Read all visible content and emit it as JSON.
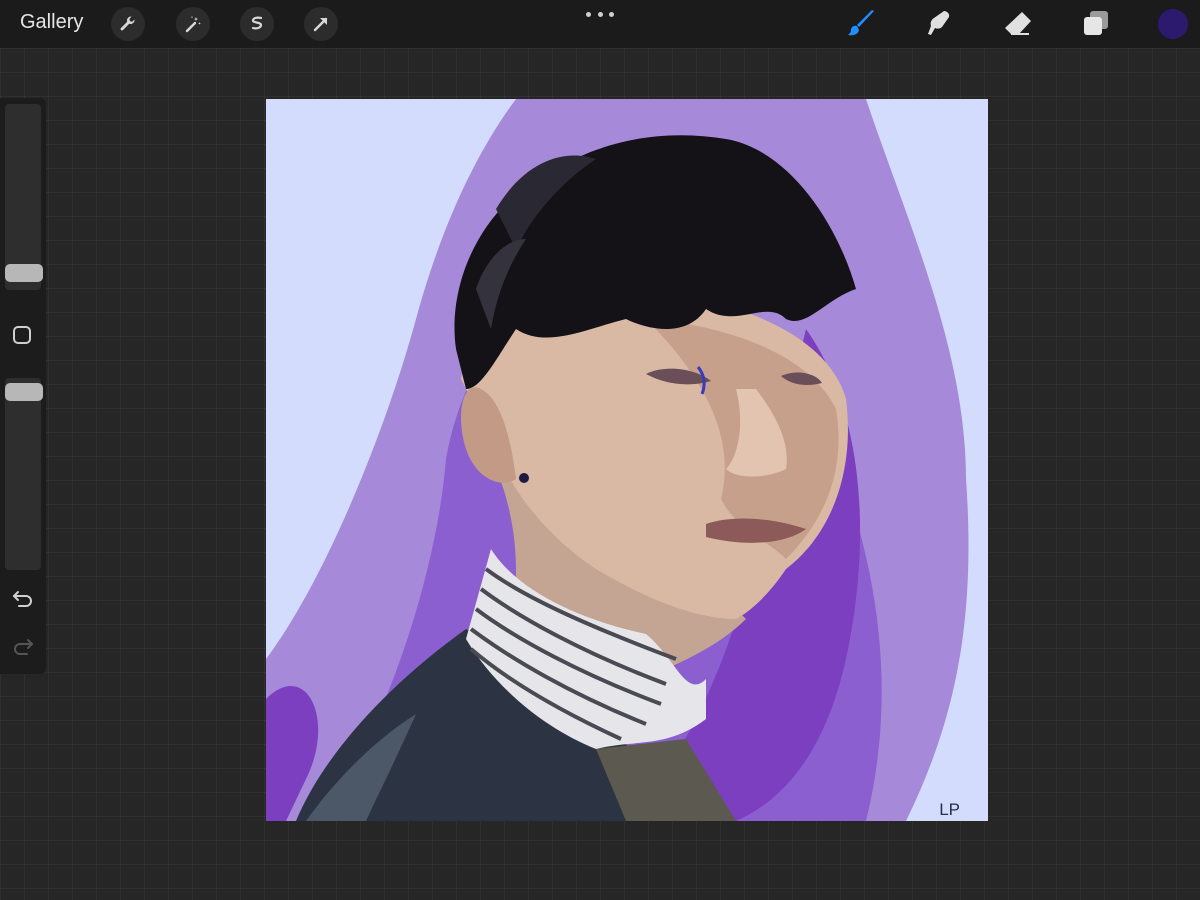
{
  "topbar": {
    "gallery_label": "Gallery",
    "tools": [
      "wrench-icon",
      "magic-wand-icon",
      "selection-icon",
      "transform-arrow-icon"
    ],
    "right_tools": [
      "brush-icon",
      "smudge-icon",
      "eraser-icon",
      "layers-icon"
    ],
    "active_tool": "brush-icon",
    "current_color": "#2b1a6e",
    "accent_color": "#1f8fff"
  },
  "canvas": {
    "signature": "LP",
    "colors": {
      "background": "#d3dcfd",
      "purple_stroke": "#a68ad9",
      "deep_purple": "#7c3fc0",
      "hair": "#141216",
      "skin": "#d9b8a4",
      "shirt_stripe": "#4a4a52",
      "jacket": "#2c3444"
    }
  }
}
